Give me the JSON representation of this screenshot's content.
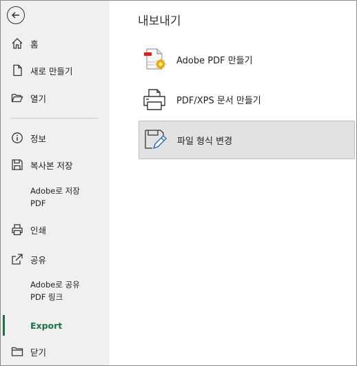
{
  "sidebar": {
    "back_label": "",
    "items": [
      {
        "label": "홈"
      },
      {
        "label": "새로 만들기"
      },
      {
        "label": "열기"
      },
      {
        "label": "정보"
      },
      {
        "label": "복사본 저장"
      },
      {
        "label_line1": "Adobe로 저장",
        "label_line2": "PDF"
      },
      {
        "label": "인쇄"
      },
      {
        "label": "공유"
      },
      {
        "label_line1": "Adobe로 공유",
        "label_line2": "PDF 링크"
      },
      {
        "label": "Export"
      },
      {
        "label": "닫기"
      }
    ],
    "active_color": "#1e7145"
  },
  "main": {
    "title": "내보내기",
    "options": [
      {
        "label": "Adobe PDF 만들기",
        "icon": "adobe-pdf-icon"
      },
      {
        "label": "PDF/XPS 문서 만들기",
        "icon": "printer-icon"
      },
      {
        "label": "파일 형식 변경",
        "icon": "file-type-edit-icon",
        "selected": true
      }
    ]
  }
}
